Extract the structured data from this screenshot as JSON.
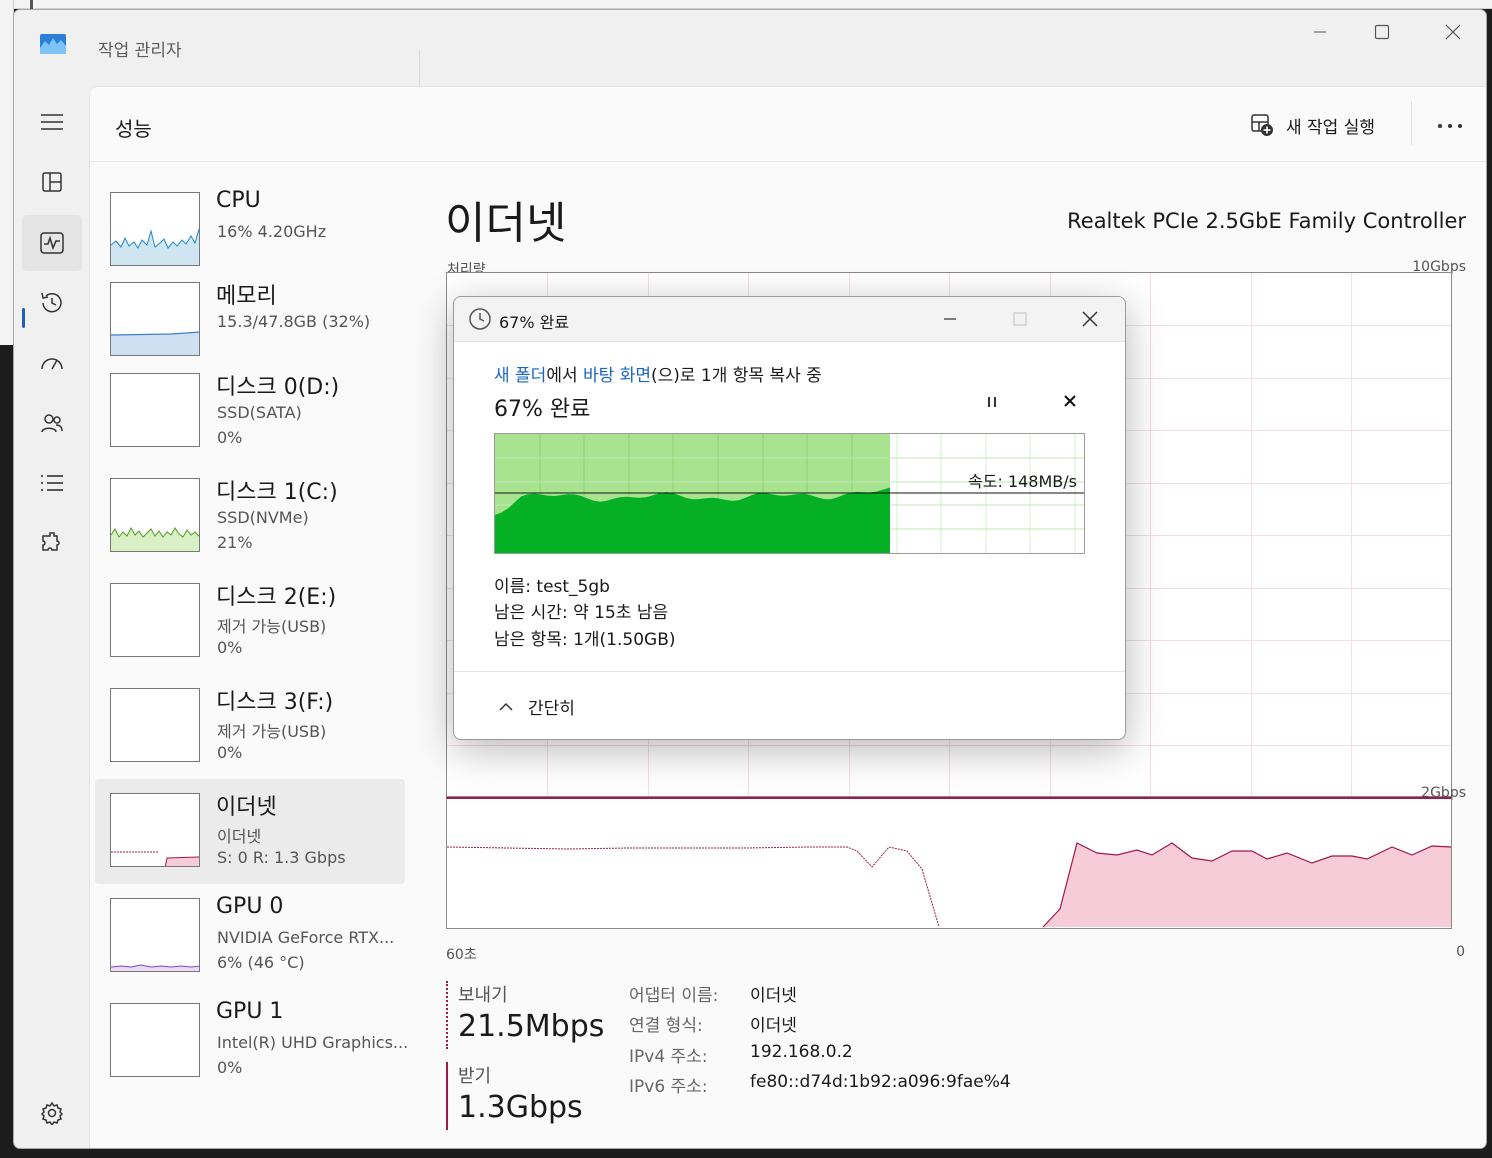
{
  "window": {
    "title": "작업 관리자"
  },
  "header": {
    "page_title": "성능",
    "run_task_label": "새 작업 실행"
  },
  "nav": {
    "items": [
      "menu-icon",
      "processes-icon",
      "performance-icon",
      "app-history-icon",
      "startup-icon",
      "users-icon",
      "details-icon",
      "services-icon",
      "settings-icon"
    ],
    "active": "performance-icon"
  },
  "resources": [
    {
      "name": "CPU",
      "sub1": "16% 4.20GHz",
      "sub2": ""
    },
    {
      "name": "메모리",
      "sub1": "15.3/47.8GB (32%)",
      "sub2": ""
    },
    {
      "name": "디스크 0(D:)",
      "sub1": "SSD(SATA)",
      "sub2": "0%"
    },
    {
      "name": "디스크 1(C:)",
      "sub1": "SSD(NVMe)",
      "sub2": "21%"
    },
    {
      "name": "디스크 2(E:)",
      "sub1": "제거 가능(USB)",
      "sub2": "0%"
    },
    {
      "name": "디스크 3(F:)",
      "sub1": "제거 가능(USB)",
      "sub2": "0%"
    },
    {
      "name": "이더넷",
      "sub1": "이더넷",
      "sub2": "S: 0  R: 1.3 Gbps"
    },
    {
      "name": "GPU 0",
      "sub1": "NVIDIA GeForce RTX...",
      "sub2": "6% (46 °C)"
    },
    {
      "name": "GPU 1",
      "sub1": "Intel(R) UHD Graphics...",
      "sub2": "0%"
    }
  ],
  "detail": {
    "title": "이더넷",
    "device": "Realtek PCIe 2.5GbE Family Controller",
    "throughput_label": "처리량",
    "max_scale": "10Gbps",
    "secondary_scale": "2Gbps",
    "axis_left": "60초",
    "axis_right": "0",
    "send_label": "보내기",
    "send_value": "21.5Mbps",
    "recv_label": "받기",
    "recv_value": "1.3Gbps",
    "props": [
      {
        "key": "어댑터 이름:",
        "value": "이더넷"
      },
      {
        "key": "연결 형식:",
        "value": "이더넷"
      },
      {
        "key": "IPv4 주소:",
        "value": "192.168.0.2"
      },
      {
        "key": "IPv6 주소:",
        "value": "fe80::d74d:1b92:a096:9fae%4"
      }
    ],
    "colors": {
      "receive": "#a0184e",
      "receive_fill": "#f7ccd9"
    }
  },
  "copy_dialog": {
    "title": "67% 완료",
    "line_from": "새 폴더",
    "line_mid": "에서 ",
    "line_to": "바탕 화면",
    "line_rest": "(으)로 1개 항목 복사 중",
    "percent_text": "67% 완료",
    "progress": 0.67,
    "speed": "속도: 148MB/s",
    "name": "이름: test_5gb",
    "time_left": "남은 시간: 약 15초 남음",
    "items_left": "남은 항목: 1개(1.50GB)",
    "collapse_label": "간단히",
    "colors": {
      "progress_fill": "#a8e38f",
      "speed_fill": "#06b025"
    }
  }
}
